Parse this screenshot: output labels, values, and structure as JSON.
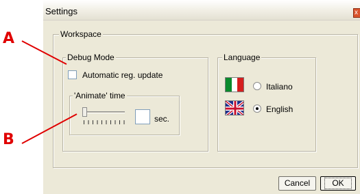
{
  "window": {
    "title": "Settings",
    "close_glyph": "x"
  },
  "workspace": {
    "legend": "Workspace",
    "debug_mode": {
      "legend": "Debug Mode",
      "auto_update": {
        "label": "Automatic reg. update",
        "checked": false
      },
      "animate": {
        "legend": "'Animate' time",
        "slider_level": 0,
        "value": "",
        "unit": "sec."
      }
    },
    "language": {
      "legend": "Language",
      "options": [
        {
          "label": "Italiano",
          "selected": false,
          "flag_icon": "italy-flag-icon"
        },
        {
          "label": "English",
          "selected": true,
          "flag_icon": "uk-flag-icon"
        }
      ]
    }
  },
  "buttons": {
    "cancel": "Cancel",
    "ok": "OK"
  },
  "annotations": {
    "a": "A",
    "b": "B",
    "color": "#e00000"
  }
}
